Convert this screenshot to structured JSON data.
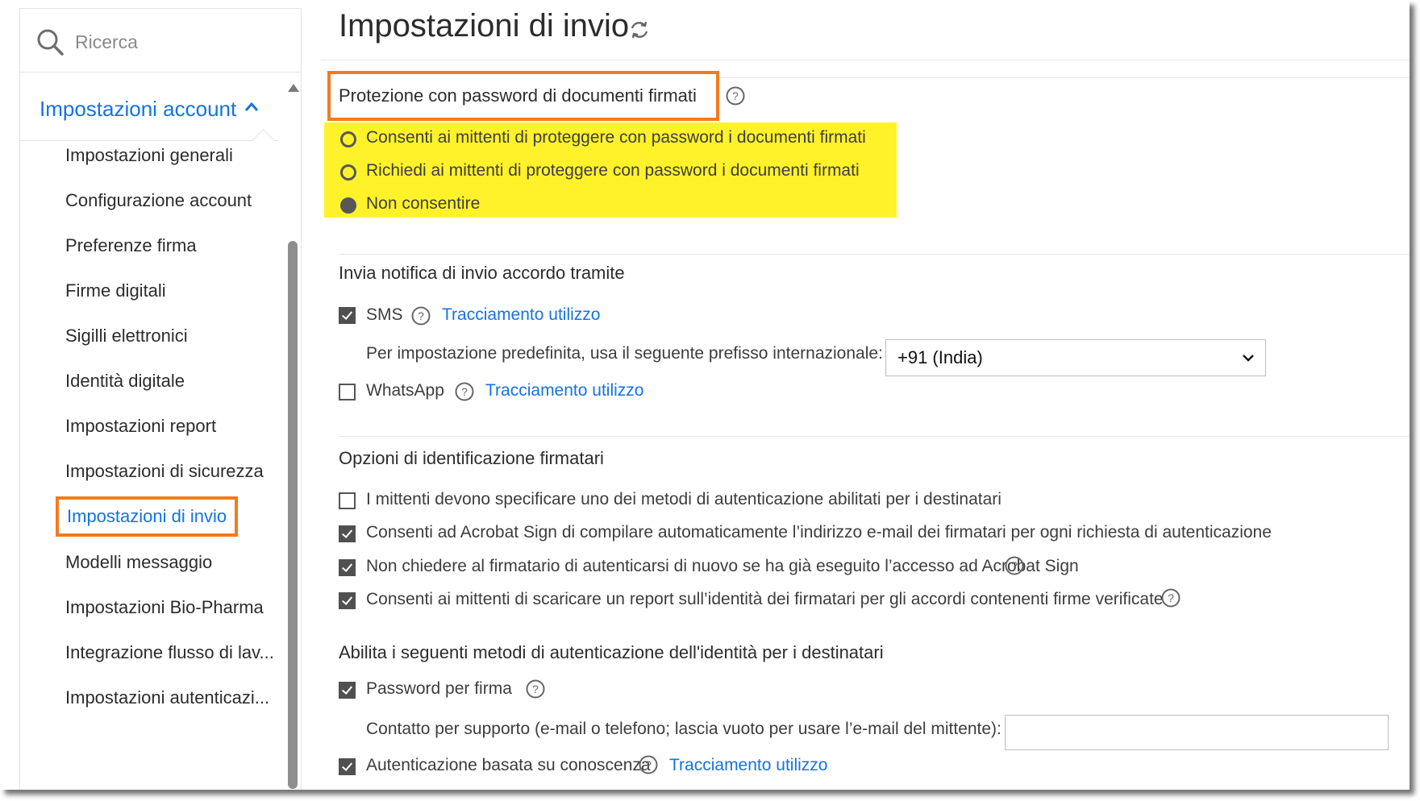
{
  "search": {
    "placeholder": "Ricerca"
  },
  "sidebar": {
    "section_label": "Impostazioni account",
    "items": [
      {
        "label": "Impostazioni generali"
      },
      {
        "label": "Configurazione account"
      },
      {
        "label": "Preferenze firma"
      },
      {
        "label": "Firme digitali"
      },
      {
        "label": "Sigilli elettronici"
      },
      {
        "label": "Identità digitale"
      },
      {
        "label": "Impostazioni report"
      },
      {
        "label": "Impostazioni di sicurezza"
      },
      {
        "label": "Impostazioni di invio",
        "active": true
      },
      {
        "label": "Modelli messaggio"
      },
      {
        "label": "Impostazioni Bio-Pharma"
      },
      {
        "label": "Integrazione flusso di lav..."
      },
      {
        "label": "Impostazioni autenticazi..."
      }
    ]
  },
  "main": {
    "title": "Impostazioni di invio",
    "password_protection": {
      "title": "Protezione con password di documenti firmati",
      "options": [
        {
          "label": "Consenti ai mittenti di proteggere con password i documenti firmati",
          "selected": false
        },
        {
          "label": "Richiedi ai mittenti di proteggere con password i documenti firmati",
          "selected": false
        },
        {
          "label": "Non consentire",
          "selected": true
        }
      ]
    },
    "notification": {
      "title": "Invia notifica di invio accordo tramite",
      "sms_label": "SMS",
      "sms_checked": true,
      "tracking_link": "Tracciamento utilizzo",
      "prefix_label": "Per impostazione predefinita, usa il seguente prefisso internazionale:",
      "prefix_value": "+91 (India)",
      "whatsapp_label": "WhatsApp",
      "whatsapp_checked": false
    },
    "identification": {
      "title": "Opzioni di identificazione firmatari",
      "options": [
        {
          "label": "I mittenti devono specificare uno dei metodi di autenticazione abilitati per i destinatari",
          "checked": false
        },
        {
          "label": "Consenti ad Acrobat Sign di compilare automaticamente l’indirizzo e-mail dei firmatari per ogni richiesta di autenticazione",
          "checked": true
        },
        {
          "label": "Non chiedere al firmatario di autenticarsi di nuovo se ha già eseguito l’accesso ad Acrobat Sign",
          "checked": true
        },
        {
          "label": "Consenti ai mittenti di scaricare un report sull’identità dei firmatari per gli accordi contenenti firme verificate",
          "checked": true
        }
      ]
    },
    "auth_methods": {
      "title": "Abilita i seguenti metodi di autenticazione dell'identità per i destinatari",
      "password_label": "Password per firma",
      "password_checked": true,
      "support_contact_label": "Contatto per supporto (e-mail o telefono; lascia vuoto per usare l’e-mail del mittente):",
      "support_contact_value": "",
      "kba_label": "Autenticazione basata su conoscenza",
      "kba_checked": true,
      "tracking_link": "Tracciamento utilizzo"
    }
  },
  "colors": {
    "accent_blue": "#1473e6",
    "highlight_orange": "#f47a20",
    "highlight_yellow": "#fff22a"
  }
}
